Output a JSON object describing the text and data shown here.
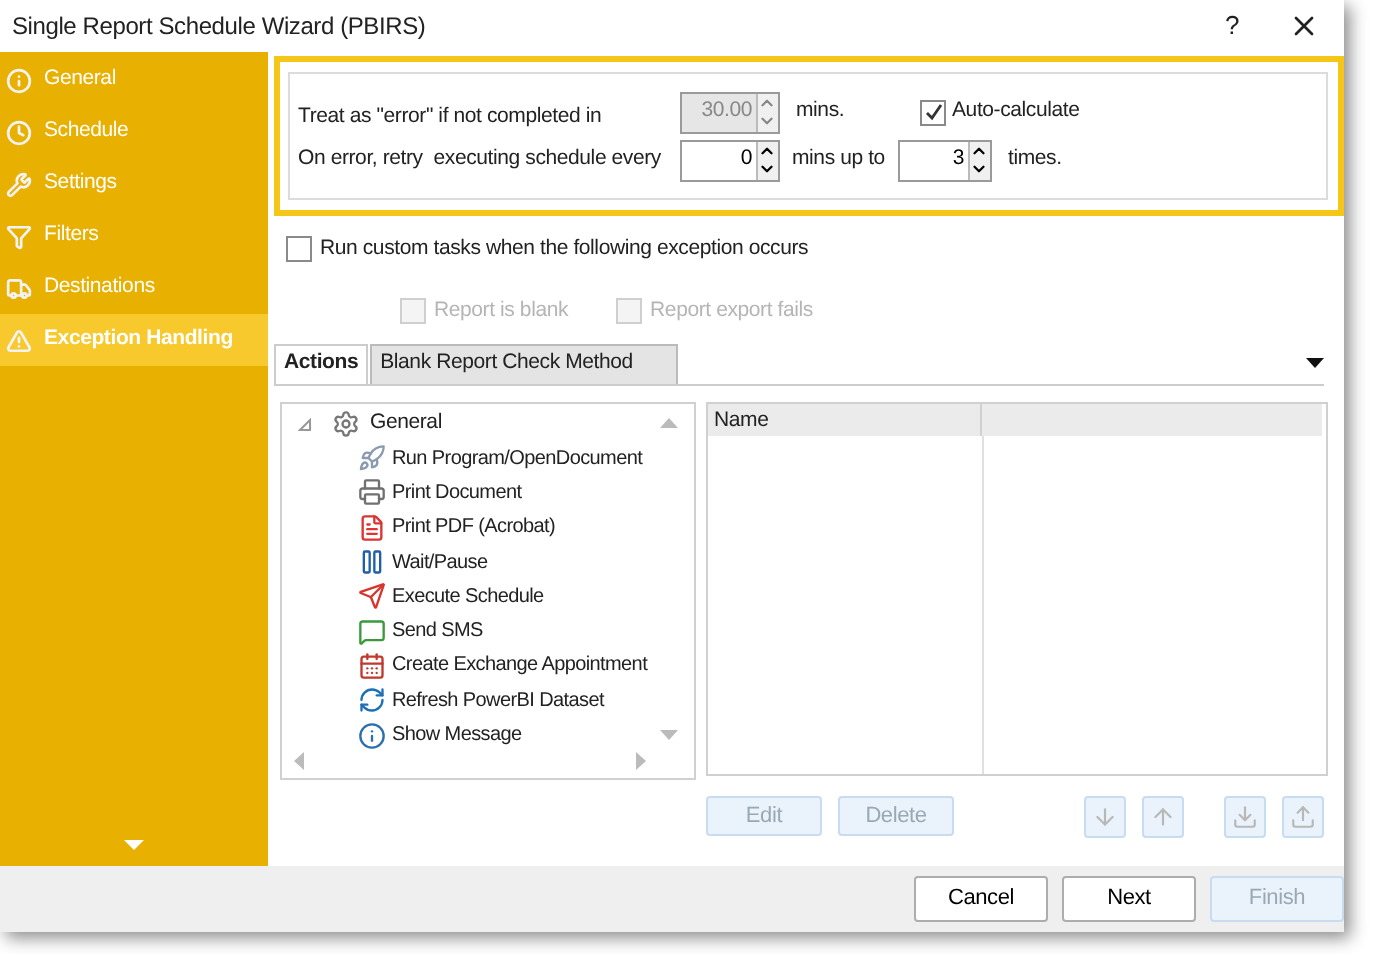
{
  "window": {
    "title": "Single Report Schedule Wizard (PBIRS)",
    "help": "?"
  },
  "sidebar": {
    "items": [
      {
        "label": "General",
        "selected": false
      },
      {
        "label": "Schedule",
        "selected": false
      },
      {
        "label": "Settings",
        "selected": false
      },
      {
        "label": "Filters",
        "selected": false
      },
      {
        "label": "Destinations",
        "selected": false
      },
      {
        "label": "Exception Handling",
        "selected": true
      }
    ]
  },
  "timeout": {
    "label": "Treat as \"error\" if not completed in",
    "value": "30.00",
    "disabled": true,
    "unit": "mins."
  },
  "auto_calculate": {
    "label": "Auto-calculate",
    "checked": true
  },
  "retry": {
    "label": "On error, retry  executing schedule every",
    "value": "0",
    "unit": "mins up to",
    "times_value": "3",
    "times_unit": "times."
  },
  "run_custom_tasks": {
    "label": "Run custom tasks when the following exception occurs",
    "checked": false
  },
  "exceptions": [
    {
      "label": "Report is blank",
      "checked": false,
      "disabled": true
    },
    {
      "label": "Report export fails",
      "checked": false,
      "disabled": true
    }
  ],
  "tabs": [
    {
      "label": "Actions",
      "selected": true
    },
    {
      "label": "Blank Report Check Method",
      "selected": false
    }
  ],
  "tree": {
    "label": "General",
    "expanded": true,
    "children": [
      {
        "label": "Run Program/OpenDocument"
      },
      {
        "label": "Print Document"
      },
      {
        "label": "Print PDF (Acrobat)"
      },
      {
        "label": "Wait/Pause"
      },
      {
        "label": "Execute Schedule"
      },
      {
        "label": "Send SMS"
      },
      {
        "label": "Create Exchange Appointment"
      },
      {
        "label": "Refresh PowerBI Dataset"
      },
      {
        "label": "Show Message"
      }
    ]
  },
  "list": {
    "columns": [
      "Name"
    ]
  },
  "action_buttons": [
    {
      "label": "Edit",
      "disabled": true
    },
    {
      "label": "Delete",
      "disabled": true
    }
  ],
  "footer_buttons": [
    {
      "label": "Cancel",
      "disabled": false
    },
    {
      "label": "Next",
      "disabled": false
    },
    {
      "label": "Finish",
      "disabled": true
    }
  ]
}
